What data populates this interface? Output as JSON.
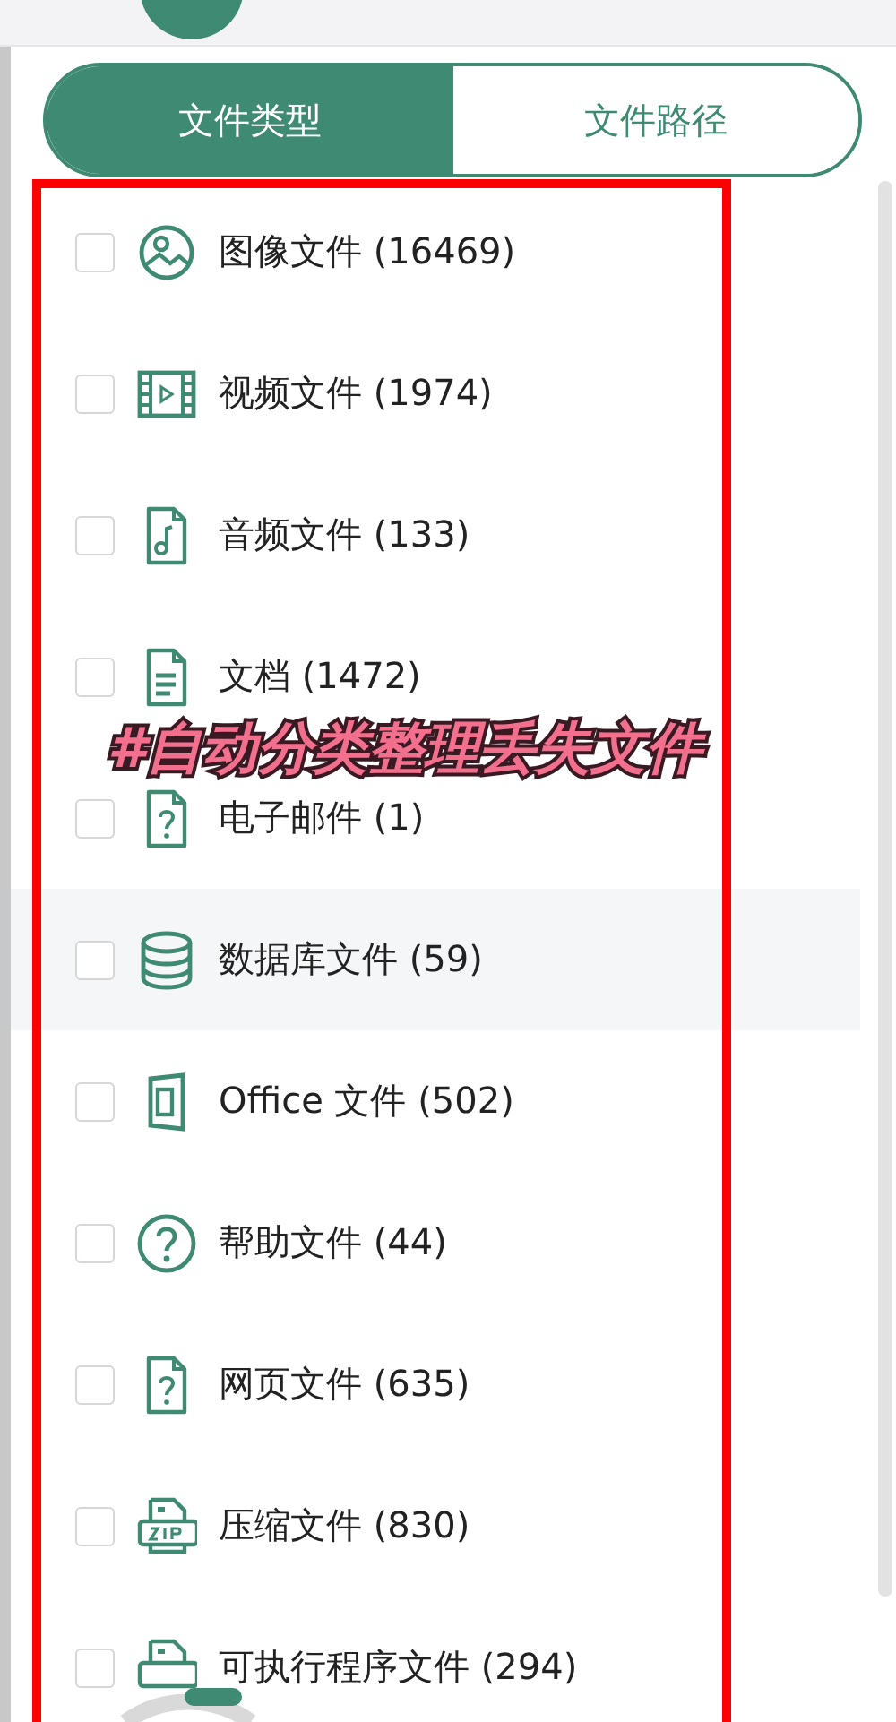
{
  "tabs": [
    {
      "label": "文件类型",
      "selected": true
    },
    {
      "label": "文件路径",
      "selected": false
    }
  ],
  "file_types": [
    {
      "kind": "image",
      "label": "图像文件 (16469)",
      "checked": false,
      "hovered": false
    },
    {
      "kind": "video",
      "label": "视频文件 (1974)",
      "checked": false,
      "hovered": false
    },
    {
      "kind": "audio",
      "label": "音频文件 (133)",
      "checked": false,
      "hovered": false
    },
    {
      "kind": "document",
      "label": "文档 (1472)",
      "checked": false,
      "hovered": false
    },
    {
      "kind": "unknown",
      "label": "电子邮件 (1)",
      "checked": false,
      "hovered": false
    },
    {
      "kind": "database",
      "label": "数据库文件 (59)",
      "checked": false,
      "hovered": true
    },
    {
      "kind": "office",
      "label": "Office 文件 (502)",
      "checked": false,
      "hovered": false
    },
    {
      "kind": "help",
      "label": "帮助文件 (44)",
      "checked": false,
      "hovered": false
    },
    {
      "kind": "unknown",
      "label": "网页文件 (635)",
      "checked": false,
      "hovered": false
    },
    {
      "kind": "zip",
      "label": "压缩文件 (830)",
      "checked": false,
      "hovered": false
    },
    {
      "kind": "executable",
      "label": "可执行程序文件 (294)",
      "checked": false,
      "hovered": false
    }
  ],
  "overlay_caption": "#自动分类整理丢失文件"
}
